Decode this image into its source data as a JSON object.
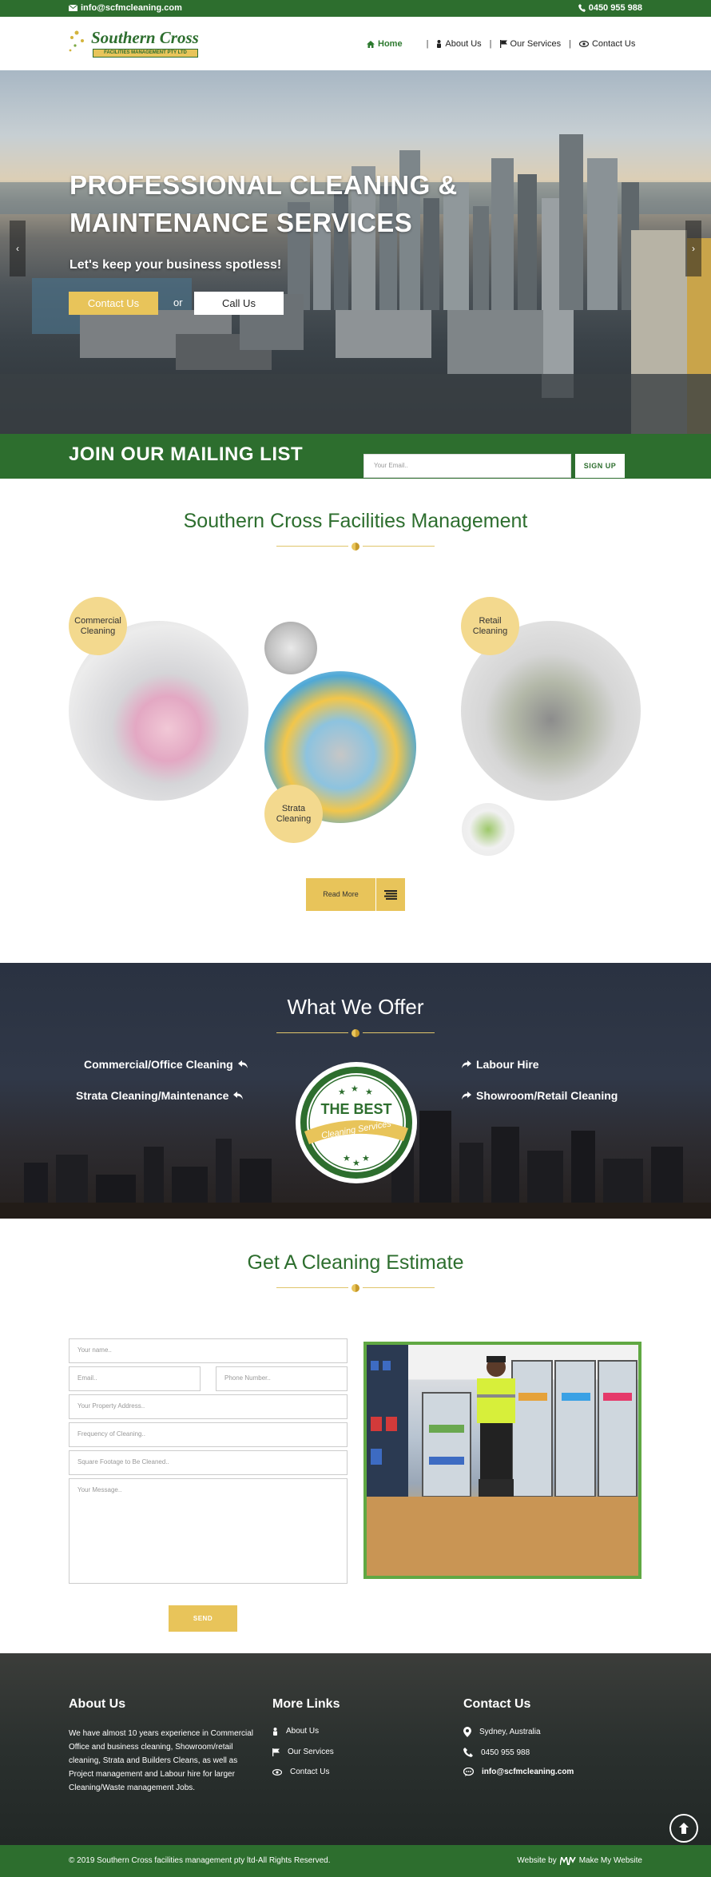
{
  "topbar": {
    "email": "info@scfmcleaning.com",
    "phone": "0450 955 988"
  },
  "logo": {
    "name": "Southern Cross",
    "tagline": "FACILITIES MANAGEMENT PTY LTD"
  },
  "nav": {
    "home": "Home",
    "about": "About Us",
    "services": "Our Services",
    "contact": "Contact Us"
  },
  "hero": {
    "title_line1": "PROFESSIONAL CLEANING &",
    "title_line2": "MAINTENANCE SERVICES",
    "subtitle": "Let's keep your business spotless!",
    "contact_button": "Contact Us",
    "or": "or",
    "call_button": "Call Us"
  },
  "mailing": {
    "title": "JOIN OUR MAILING LIST",
    "placeholder": "Your Email..",
    "button": "SIGN UP"
  },
  "intro": {
    "title": "Southern Cross Facilities Management"
  },
  "services": {
    "commercial": "Commercial Cleaning",
    "strata": "Strata Cleaning",
    "retail": "Retail Cleaning",
    "read_more": "Read More"
  },
  "offer": {
    "title": "What We Offer",
    "items": [
      "Commercial/Office Cleaning",
      "Strata Cleaning/Maintenance",
      "Labour Hire",
      "Showroom/Retail Cleaning"
    ],
    "seal_top": "THE BEST",
    "seal_ribbon": "Cleaning Services"
  },
  "estimate": {
    "title": "Get A Cleaning Estimate",
    "name": "Your name..",
    "email": "Email..",
    "phone": "Phone Number..",
    "address": "Your Property Address..",
    "frequency": "Frequency of Cleaning..",
    "footage": "Square Footage to Be Cleaned..",
    "message": "Your Message..",
    "send": "SEND"
  },
  "footer": {
    "about_title": "About Us",
    "about_text": "We have almost 10 years experience in Commercial Office and business cleaning, Showroom/retail cleaning, Strata and Builders Cleans, as well as Project management and Labour hire for larger Cleaning/Waste management Jobs.",
    "links_title": "More Links",
    "links": [
      "About Us",
      "Our Services",
      "Contact Us"
    ],
    "contact_title": "Contact Us",
    "location": "Sydney, Australia",
    "phone": "0450 955 988",
    "email": "info@scfmcleaning.com",
    "copyright": "© 2019 Southern Cross facilities management pty ltd-All Rights Reserved.",
    "credit_prefix": "Website by",
    "credit": "Make My Website"
  },
  "colors": {
    "green": "#2d6e2e",
    "gold": "#e8c45a"
  }
}
